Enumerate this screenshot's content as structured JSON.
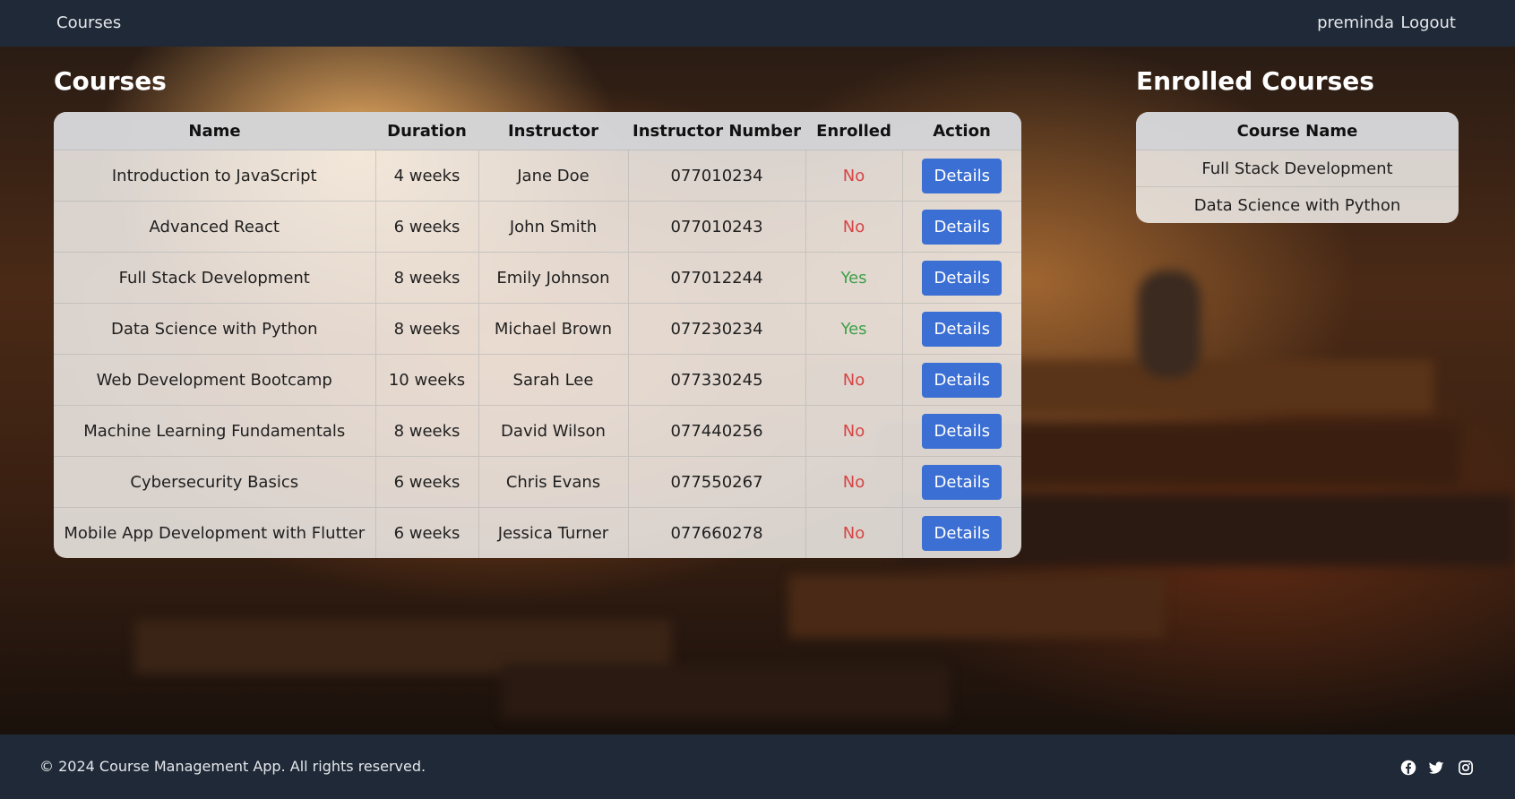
{
  "nav": {
    "brand": "Courses",
    "user": "preminda",
    "logout": "Logout"
  },
  "courses": {
    "title": "Courses",
    "headers": [
      "Name",
      "Duration",
      "Instructor",
      "Instructor Number",
      "Enrolled",
      "Action"
    ],
    "rows": [
      {
        "name": "Introduction to JavaScript",
        "duration": "4 weeks",
        "instructor": "Jane Doe",
        "number": "077010234",
        "enrolled": "No",
        "action": "Details"
      },
      {
        "name": "Advanced React",
        "duration": "6 weeks",
        "instructor": "John Smith",
        "number": "077010243",
        "enrolled": "No",
        "action": "Details"
      },
      {
        "name": "Full Stack Development",
        "duration": "8 weeks",
        "instructor": "Emily Johnson",
        "number": "077012244",
        "enrolled": "Yes",
        "action": "Details"
      },
      {
        "name": "Data Science with Python",
        "duration": "8 weeks",
        "instructor": "Michael Brown",
        "number": "077230234",
        "enrolled": "Yes",
        "action": "Details"
      },
      {
        "name": "Web Development Bootcamp",
        "duration": "10 weeks",
        "instructor": "Sarah Lee",
        "number": "077330245",
        "enrolled": "No",
        "action": "Details"
      },
      {
        "name": "Machine Learning Fundamentals",
        "duration": "8 weeks",
        "instructor": "David Wilson",
        "number": "077440256",
        "enrolled": "No",
        "action": "Details"
      },
      {
        "name": "Cybersecurity Basics",
        "duration": "6 weeks",
        "instructor": "Chris Evans",
        "number": "077550267",
        "enrolled": "No",
        "action": "Details"
      },
      {
        "name": "Mobile App Development with Flutter",
        "duration": "6 weeks",
        "instructor": "Jessica Turner",
        "number": "077660278",
        "enrolled": "No",
        "action": "Details"
      }
    ]
  },
  "enrolled": {
    "title": "Enrolled Courses",
    "header": "Course Name",
    "items": [
      "Full Stack Development",
      "Data Science with Python"
    ]
  },
  "footer": {
    "copyright": "© 2024 Course Management App. All rights reserved.",
    "social_icons": [
      "facebook-icon",
      "twitter-icon",
      "instagram-icon"
    ]
  },
  "colors": {
    "navbar": "#1f2937",
    "button": "#3b6fd4",
    "enrolled_no": "#d64545",
    "enrolled_yes": "#3fa04a"
  }
}
